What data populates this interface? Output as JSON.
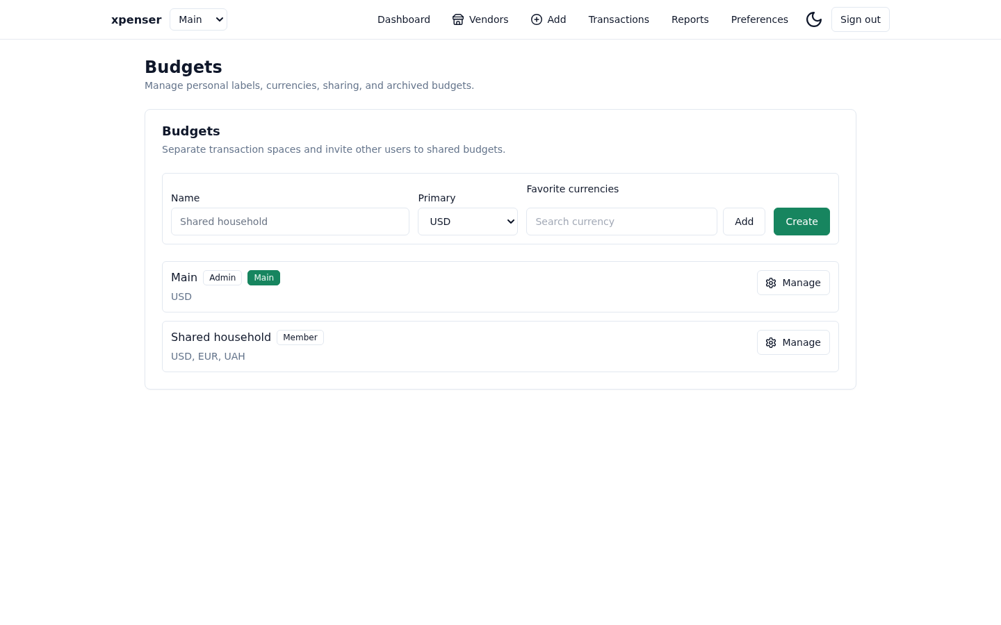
{
  "header": {
    "brand": "xpenser",
    "budget_select": {
      "value": "Main"
    },
    "nav": [
      {
        "label": "Dashboard"
      },
      {
        "label": "Vendors"
      },
      {
        "label": "Add"
      },
      {
        "label": "Transactions"
      },
      {
        "label": "Reports"
      },
      {
        "label": "Preferences"
      }
    ],
    "sign_out": "Sign out"
  },
  "page": {
    "title": "Budgets",
    "subtitle": "Manage personal labels, currencies, sharing, and archived budgets."
  },
  "card": {
    "title": "Budgets",
    "subtitle": "Separate transaction spaces and invite other users to shared budgets.",
    "form": {
      "fields": [
        {
          "kind": "text",
          "label": "Name",
          "placeholder": "Shared household"
        },
        {
          "kind": "select",
          "label": "Primary",
          "value": "USD"
        },
        {
          "kind": "search",
          "label": "Favorite currencies",
          "placeholder": "Search currency",
          "button": "Add"
        }
      ],
      "submit": "Create"
    },
    "budgets": [
      {
        "name": "Main",
        "badges": [
          {
            "label": "Admin",
            "kind": "role"
          },
          {
            "label": "Main",
            "kind": "default"
          }
        ],
        "currencies": "USD",
        "action": "Manage"
      },
      {
        "name": "Shared household",
        "badges": [
          {
            "label": "Member",
            "kind": "role"
          }
        ],
        "currencies": "USD, EUR, UAH",
        "action": "Manage"
      }
    ]
  }
}
